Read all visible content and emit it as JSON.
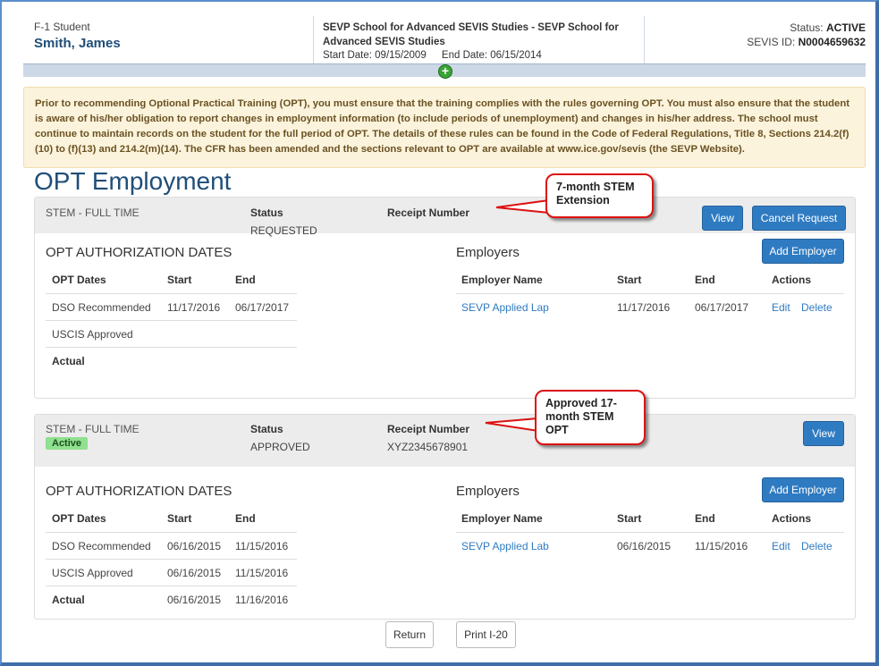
{
  "header": {
    "student_type": "F-1 Student",
    "student_name": "Smith, James",
    "school_name": "SEVP School for Advanced SEVIS Studies - SEVP School for Advanced SEVIS Studies",
    "start_date": "Start Date: 09/15/2009",
    "end_date": "End Date: 06/15/2014",
    "status_label": "Status:",
    "status_value": "ACTIVE",
    "sevis_label": "SEVIS ID:",
    "sevis_value": "N0004659632"
  },
  "notice": "Prior to recommending Optional Practical Training (OPT), you must ensure that the training complies with the rules governing OPT. You must also ensure that the student is aware of his/her obligation to report changes in employment information (to include periods of unemployment) and changes in his/her address. The school must continue to maintain records on the student for the full period of OPT. The details of these rules can be found in the Code of Federal Regulations, Title 8, Sections 214.2(f)(10) to (f)(13) and 214.2(m)(14). The CFR has been amended and the sections relevant to OPT are available at www.ice.gov/sevis (the SEVP Website).",
  "page_title": "OPT Employment",
  "panels": [
    {
      "type": "STEM - FULL TIME",
      "status_label": "Status",
      "status_value": "REQUESTED",
      "receipt_label": "Receipt Number",
      "receipt_value": "",
      "view_label": "View",
      "cancel_label": "Cancel Request",
      "dates_title": "OPT AUTHORIZATION DATES",
      "dates_cols": [
        "OPT Dates",
        "Start",
        "End"
      ],
      "dates_rows": [
        [
          "DSO Recommended",
          "11/17/2016",
          "06/17/2017"
        ],
        [
          "USCIS Approved",
          "",
          ""
        ],
        [
          "Actual",
          "",
          ""
        ]
      ],
      "employers_title": "Employers",
      "add_employer_label": "Add Employer",
      "emp_cols": [
        "Employer Name",
        "Start",
        "End",
        "Actions"
      ],
      "emp_rows": [
        {
          "name": "SEVP Applied Lap",
          "start": "11/17/2016",
          "end": "06/17/2017",
          "edit": "Edit",
          "delete": "Delete"
        }
      ]
    },
    {
      "type": "STEM - FULL TIME",
      "badge": "Active",
      "status_label": "Status",
      "status_value": "APPROVED",
      "receipt_label": "Receipt Number",
      "receipt_value": "XYZ2345678901",
      "view_label": "View",
      "dates_title": "OPT AUTHORIZATION DATES",
      "dates_cols": [
        "OPT Dates",
        "Start",
        "End"
      ],
      "dates_rows": [
        [
          "DSO Recommended",
          "06/16/2015",
          "11/15/2016"
        ],
        [
          "USCIS Approved",
          "06/16/2015",
          "11/15/2016"
        ],
        [
          "Actual",
          "06/16/2015",
          "11/16/2016"
        ]
      ],
      "employers_title": "Employers",
      "add_employer_label": "Add Employer",
      "emp_cols": [
        "Employer Name",
        "Start",
        "End",
        "Actions"
      ],
      "emp_rows": [
        {
          "name": "SEVP Applied Lab",
          "start": "06/16/2015",
          "end": "11/15/2016",
          "edit": "Edit",
          "delete": "Delete"
        }
      ]
    }
  ],
  "callouts": {
    "first": "7-month STEM Extension",
    "second": "Approved 17-month STEM OPT"
  },
  "footer": {
    "return_label": "Return",
    "print_label": "Print I-20"
  },
  "colors": {
    "primary_button": "#2f7bc2",
    "title": "#1f4e79",
    "notice_bg": "#fcf3dc",
    "callout_border": "#dd1111",
    "active_badge": "#8fe08f"
  }
}
